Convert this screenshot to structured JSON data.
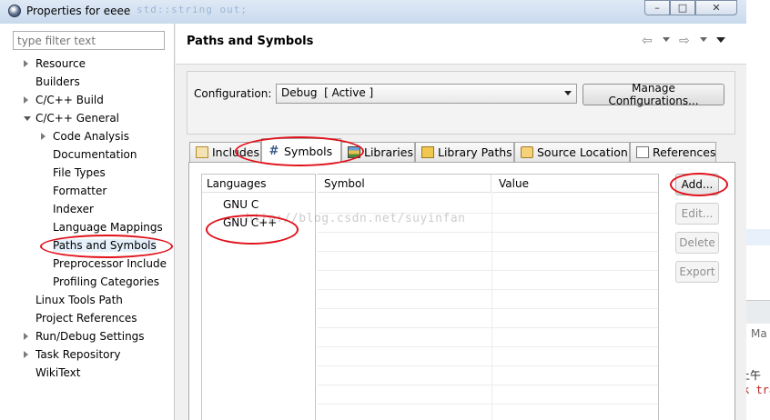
{
  "window": {
    "title": "Properties for eeee",
    "background_code": "std::string out;"
  },
  "filter": {
    "placeholder": "type filter text"
  },
  "tree": [
    {
      "label": "Resource",
      "expander": "collapsed"
    },
    {
      "label": "Builders",
      "expander": "none"
    },
    {
      "label": "C/C++ Build",
      "expander": "collapsed"
    },
    {
      "label": "C/C++ General",
      "expander": "expanded"
    },
    {
      "label": "Code Analysis",
      "expander": "collapsed"
    },
    {
      "label": "Documentation",
      "expander": "none"
    },
    {
      "label": "File Types",
      "expander": "none"
    },
    {
      "label": "Formatter",
      "expander": "none"
    },
    {
      "label": "Indexer",
      "expander": "none"
    },
    {
      "label": "Language Mappings",
      "expander": "none"
    },
    {
      "label": "Paths and Symbols",
      "expander": "none",
      "selected": true
    },
    {
      "label": "Preprocessor Include",
      "expander": "none"
    },
    {
      "label": "Profiling Categories",
      "expander": "none"
    },
    {
      "label": "Linux Tools Path",
      "expander": "none"
    },
    {
      "label": "Project References",
      "expander": "none"
    },
    {
      "label": "Run/Debug Settings",
      "expander": "collapsed"
    },
    {
      "label": "Task Repository",
      "expander": "collapsed"
    },
    {
      "label": "WikiText",
      "expander": "none"
    }
  ],
  "page": {
    "title": "Paths and Symbols",
    "configuration_label": "Configuration:",
    "configuration_value": "Debug  [ Active ]",
    "manage_button": "Manage Configurations..."
  },
  "tabs": [
    {
      "label": "Includes",
      "icon": "includes-icon"
    },
    {
      "label": "Symbols",
      "icon": "hash-icon",
      "active": true
    },
    {
      "label": "Libraries",
      "icon": "libraries-icon"
    },
    {
      "label": "Library Paths",
      "icon": "library-paths-icon"
    },
    {
      "label": "Source Location",
      "icon": "folder-icon"
    },
    {
      "label": "References",
      "icon": "references-icon"
    }
  ],
  "languages": {
    "header": "Languages",
    "items": [
      "GNU C",
      "GNU C++"
    ]
  },
  "symbols_table": {
    "columns": [
      "Symbol",
      "Value"
    ],
    "rows": []
  },
  "buttons": {
    "add": "Add...",
    "edit": "Edit...",
    "delete": "Delete",
    "export": "Export"
  },
  "watermark": "http://blog.csdn.net/suyinfan",
  "background_window": {
    "fragment_ma": "Ma",
    "fragment_time": "上午",
    "fragment_code": "k tra"
  },
  "colors": {
    "annotation_red": "#e0121b",
    "selection": "#e5f0fb"
  }
}
